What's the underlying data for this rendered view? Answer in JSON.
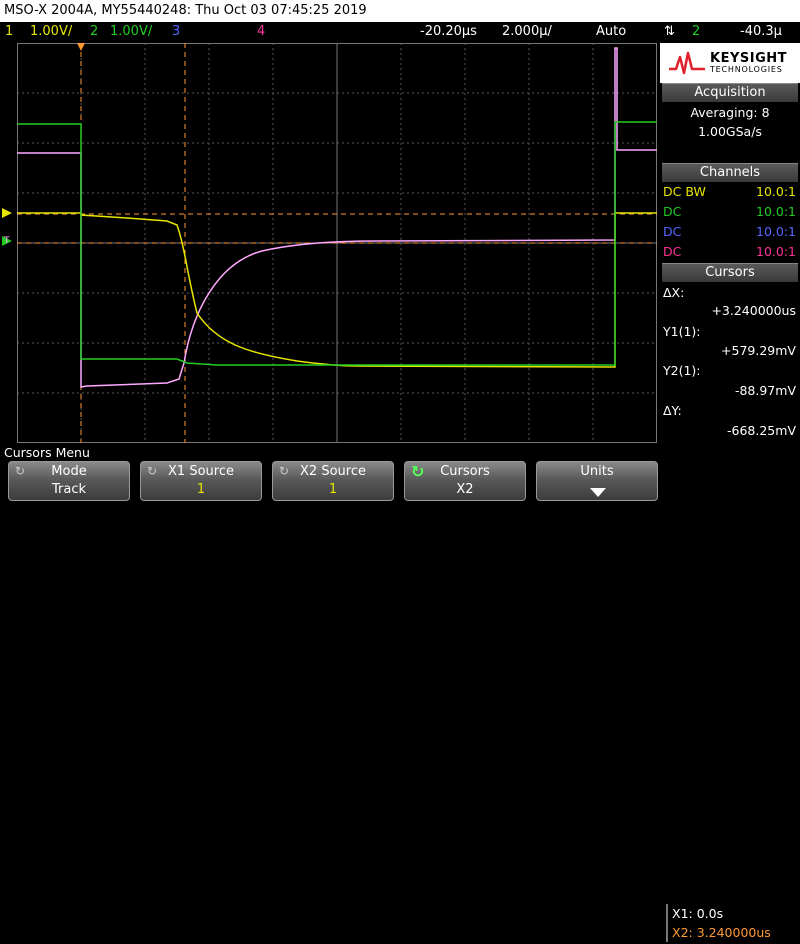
{
  "title": "MSO-X 2004A, MY55440248: Thu Oct 03 07:45:25 2019",
  "channel_bar": {
    "ch1": {
      "num": "1",
      "scale": "1.00V/"
    },
    "ch2": {
      "num": "2",
      "scale": "1.00V/"
    },
    "ch3": {
      "num": "3"
    },
    "ch4": {
      "num": "4"
    },
    "time_pos": "-20.20µs",
    "time_div": "2.000µ/",
    "trigger_mode": "Auto",
    "trigger_channel": "2",
    "trigger_level": "-40.3µ"
  },
  "colors": {
    "ch1": "#e6e600",
    "ch2": "#22cc22",
    "ch3": "#5566ff",
    "ch4": "#ff3399",
    "trace4": "#ffa8ff",
    "cursor": "#ff9933",
    "grid": "#5a5a5a"
  },
  "logo": {
    "brand": "KEYSIGHT",
    "sub": "TECHNOLOGIES"
  },
  "acquisition": {
    "header": "Acquisition",
    "averaging": "Averaging: 8",
    "rate": "1.00GSa/s"
  },
  "channels": {
    "header": "Channels",
    "rows": [
      {
        "coupling": "DC BW",
        "probe": "10.0:1"
      },
      {
        "coupling": "DC",
        "probe": "10.0:1"
      },
      {
        "coupling": "DC",
        "probe": "10.0:1"
      },
      {
        "coupling": "DC",
        "probe": "10.0:1"
      }
    ]
  },
  "cursors": {
    "header": "Cursors",
    "dx_label": "ΔX:",
    "dx": "+3.240000us",
    "y1_label": "Y1(1):",
    "y1": "+579.29mV",
    "y2_label": "Y2(1):",
    "y2": "-88.97mV",
    "dy_label": "ΔY:",
    "dy": "-668.25mV"
  },
  "menu": {
    "title": "Cursors Menu",
    "keys": [
      {
        "label": "Mode",
        "value": "Track"
      },
      {
        "label": "X1 Source",
        "value": "1"
      },
      {
        "label": "X2 Source",
        "value": "1"
      },
      {
        "label": "Cursors",
        "value": "X2"
      },
      {
        "label": "Units",
        "value": ""
      }
    ],
    "readout_x1": "X1: 0.0s",
    "readout_x2": "X2: 3.240000us"
  }
}
